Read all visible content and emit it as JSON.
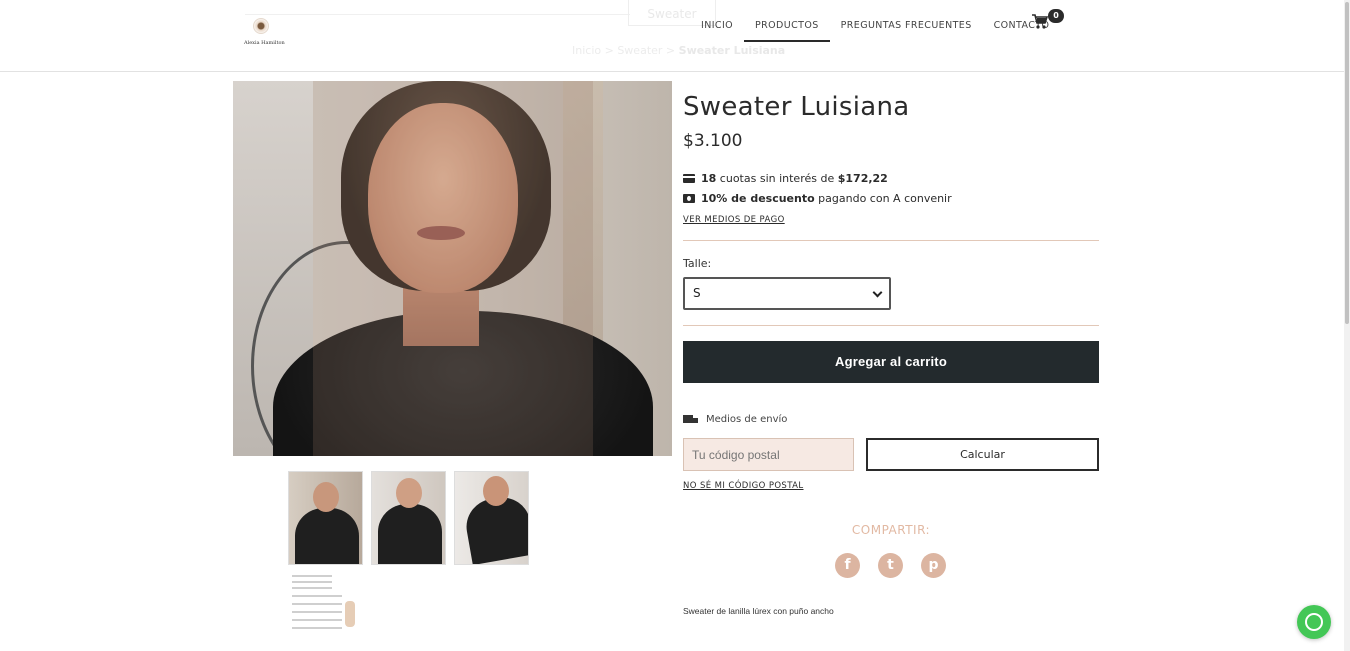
{
  "header": {
    "logo_text": "Alexia Hamilton",
    "ghost_search_label": "Sweater",
    "ghost_breadcrumb": {
      "home": "Inicio",
      "sep1": ">",
      "category": "Sweater",
      "sep2": ">",
      "current": "Sweater Luisiana"
    },
    "nav": [
      {
        "label": "INICIO",
        "active": false
      },
      {
        "label": "PRODUCTOS",
        "active": true
      },
      {
        "label": "PREGUNTAS FRECUENTES",
        "active": false
      },
      {
        "label": "CONTACTO",
        "active": false
      }
    ],
    "cart_count": "0",
    "cart_icon": "shopping-cart-icon"
  },
  "product": {
    "title": "Sweater Luisiana",
    "price": "$3.100",
    "installments": {
      "count": "18",
      "text": " cuotas sin interés de ",
      "amount": "$172,22"
    },
    "discount": {
      "bold": "10% de descuento",
      "text": " pagando con A convenir"
    },
    "payment_methods_link": "VER MEDIOS DE PAGO",
    "size_label": "Talle:",
    "size_selected": "S",
    "add_to_cart_label": "Agregar al carrito",
    "shipping_title": "Medios de envío",
    "zip_placeholder": "Tu código postal",
    "calculate_label": "Calcular",
    "unknown_zip_link": "NO SÉ MI CÓDIGO POSTAL",
    "share_title": "COMPARTIR:",
    "social": [
      {
        "name": "facebook-icon",
        "glyph": "f"
      },
      {
        "name": "twitter-icon",
        "glyph": "t"
      },
      {
        "name": "pinterest-icon",
        "glyph": "p"
      }
    ],
    "description": "Sweater de lanilla lúrex con puño ancho"
  },
  "colors": {
    "accent_peach": "#e2b9a3",
    "button_dark": "#232a2d",
    "whatsapp_green": "#43c756"
  }
}
